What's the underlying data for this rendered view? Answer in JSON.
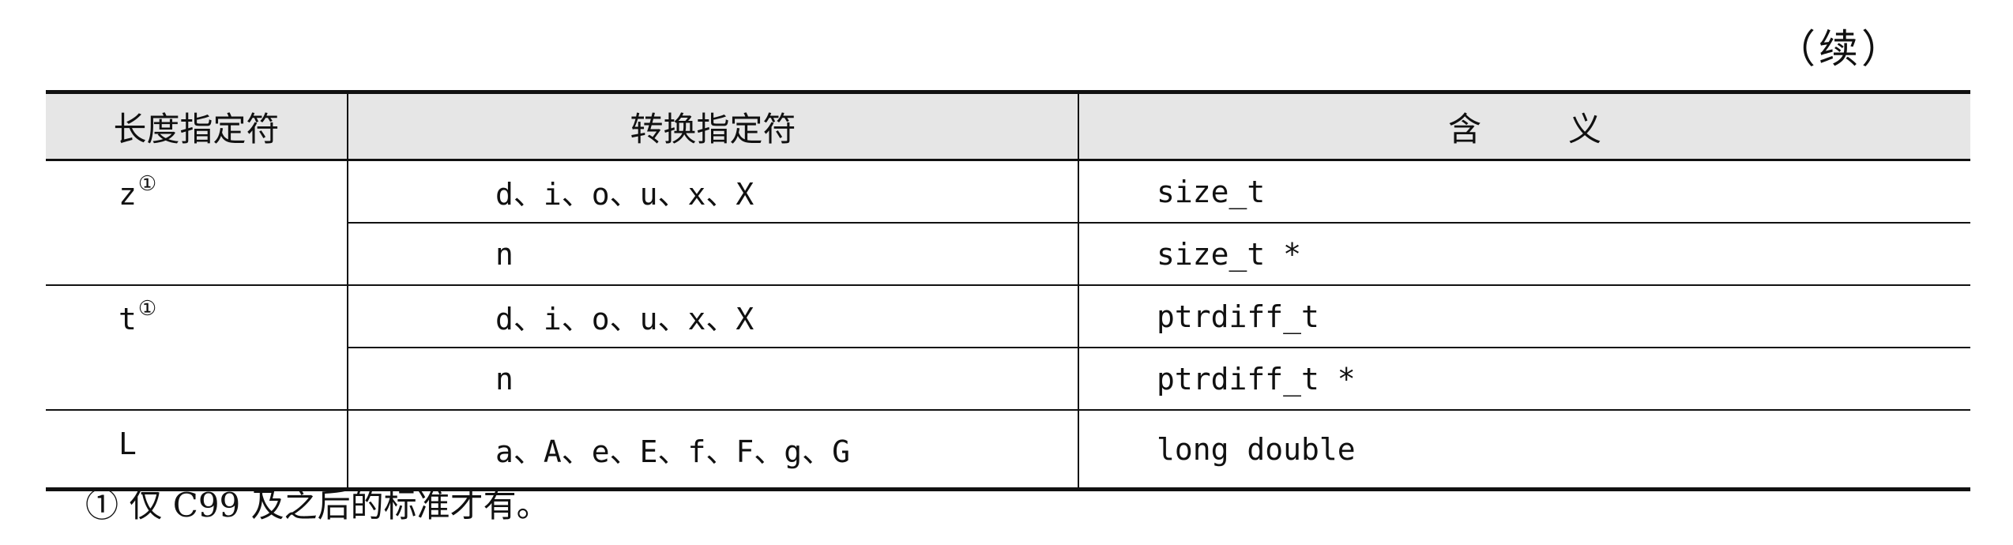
{
  "continued_label": "（续）",
  "table": {
    "headers": {
      "length": "长度指定符",
      "conversion": "转换指定符",
      "meaning_part1": "含",
      "meaning_part2": "义"
    },
    "rows": [
      {
        "length": "z",
        "length_note": "①",
        "conversion": "d、i、o、u、x、X",
        "meaning": "size_t"
      },
      {
        "length": "",
        "conversion": "n",
        "meaning": "size_t *"
      },
      {
        "length": "t",
        "length_note": "①",
        "conversion": "d、i、o、u、x、X",
        "meaning": "ptrdiff_t"
      },
      {
        "length": "",
        "conversion": "n",
        "meaning": "ptrdiff_t *"
      },
      {
        "length": "L",
        "conversion": "a、A、e、E、f、F、g、G",
        "meaning": "long double"
      }
    ]
  },
  "footnote": "① 仅 C99 及之后的标准才有。"
}
